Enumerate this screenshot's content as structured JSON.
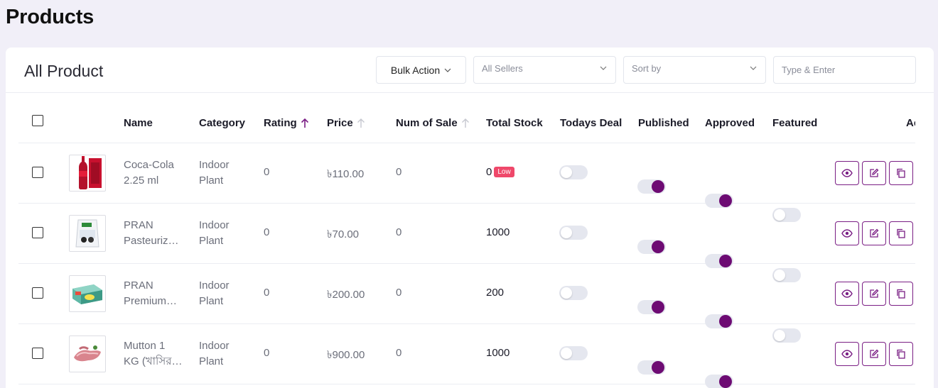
{
  "page": {
    "title": "Products"
  },
  "card": {
    "title": "All Product"
  },
  "toolbar": {
    "bulk_action_label": "Bulk Action",
    "sellers_select_value": "All Sellers",
    "sort_select_value": "Sort by",
    "search_placeholder": "Type & Enter"
  },
  "columns": {
    "name": "Name",
    "category": "Category",
    "rating": "Rating",
    "price": "Price",
    "num_of_sale": "Num of Sale",
    "total_stock": "Total Stock",
    "todays_deal": "Todays Deal",
    "published": "Published",
    "approved": "Approved",
    "featured": "Featured",
    "actions": "Actions"
  },
  "sort": {
    "rating": "active-ascending",
    "price": "inactive",
    "num_of_sale": "inactive"
  },
  "products": [
    {
      "name_line1": "Coca-Cola",
      "name_line2": "2.25 ml",
      "category_line1": "Indoor",
      "category_line2": "Plant",
      "rating": "0",
      "price": "৳110.00",
      "num_of_sale": "0",
      "total_stock": "0",
      "stock_badge": "Low",
      "todays_deal": false,
      "published": true,
      "approved": true,
      "featured": false,
      "thumb": "coke-bottle"
    },
    {
      "name_line1": "PRAN",
      "name_line2": "Pasteuriz…",
      "category_line1": "Indoor",
      "category_line2": "Plant",
      "rating": "0",
      "price": "৳70.00",
      "num_of_sale": "0",
      "total_stock": "1000",
      "stock_badge": "",
      "todays_deal": false,
      "published": true,
      "approved": true,
      "featured": false,
      "thumb": "milk-pack"
    },
    {
      "name_line1": "PRAN",
      "name_line2": "Premium…",
      "category_line1": "Indoor",
      "category_line2": "Plant",
      "rating": "0",
      "price": "৳200.00",
      "num_of_sale": "0",
      "total_stock": "200",
      "stock_badge": "",
      "todays_deal": false,
      "published": true,
      "approved": true,
      "featured": false,
      "thumb": "butter-box"
    },
    {
      "name_line1": "Mutton 1",
      "name_line2": "KG (খাসির…",
      "category_line1": "Indoor",
      "category_line2": "Plant",
      "rating": "0",
      "price": "৳900.00",
      "num_of_sale": "0",
      "total_stock": "1000",
      "stock_badge": "",
      "todays_deal": false,
      "published": true,
      "approved": true,
      "featured": false,
      "thumb": "meat"
    }
  ],
  "colors": {
    "accent": "#6d0b73",
    "badge_low": "#ef486a",
    "page_bg": "#f1eff8"
  }
}
